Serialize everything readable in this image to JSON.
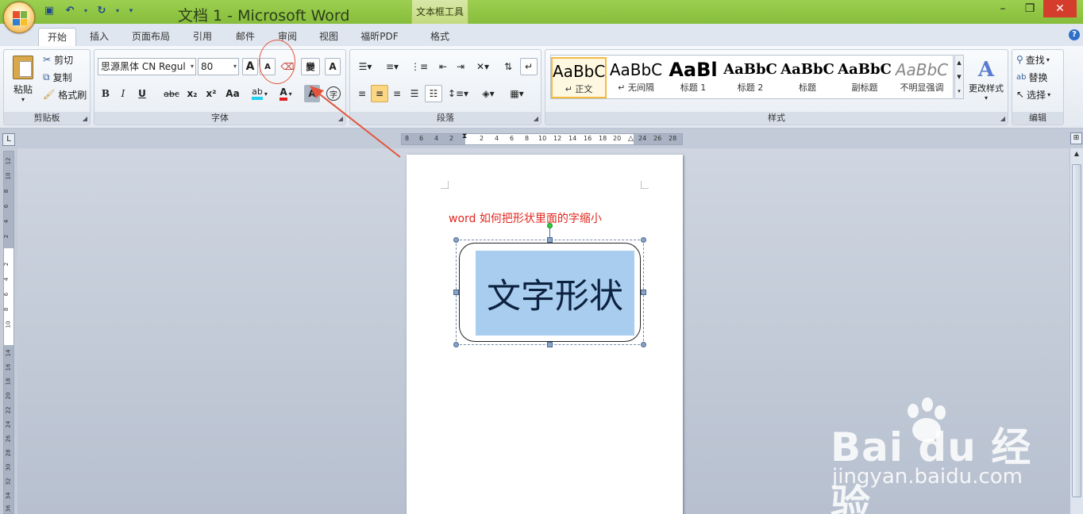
{
  "window": {
    "title": "文档 1 - Microsoft Word",
    "context_tool": "文本框工具",
    "controls": [
      "–",
      "❐",
      "✕"
    ]
  },
  "tabs": [
    {
      "label": "开始",
      "active": true
    },
    {
      "label": "插入"
    },
    {
      "label": "页面布局"
    },
    {
      "label": "引用"
    },
    {
      "label": "邮件"
    },
    {
      "label": "审阅"
    },
    {
      "label": "视图"
    },
    {
      "label": "福昕PDF"
    },
    {
      "label": "格式"
    }
  ],
  "clipboard": {
    "label": "剪贴板",
    "paste": "粘贴",
    "cut": "剪切",
    "copy": "复制",
    "format_painter": "格式刷"
  },
  "font": {
    "label": "字体",
    "font_name": "思源黑体 CN Regul",
    "font_size": "80",
    "grow": "A",
    "shrink": "A",
    "bold": "B",
    "italic": "I",
    "underline": "U",
    "strike": "abc",
    "subscript": "x₂",
    "superscript": "x²",
    "case": "Aa",
    "highlight": "ab",
    "font_color": "A",
    "char_shading": "A",
    "phonetic": "wén\n文",
    "border_char": "A",
    "enclose": "字"
  },
  "paragraph": {
    "label": "段落"
  },
  "styles": {
    "label": "样式",
    "items": [
      {
        "preview": "AaBbC",
        "name": "↵ 正文",
        "selected": true
      },
      {
        "preview": "AaBbC",
        "name": "↵ 无间隔"
      },
      {
        "preview": "AaBl",
        "name": "标题 1"
      },
      {
        "preview": "AaBbC",
        "name": "标题 2"
      },
      {
        "preview": "AaBbC",
        "name": "标题"
      },
      {
        "preview": "AaBbC",
        "name": "副标题"
      },
      {
        "preview": "AaBbC",
        "name": "不明显强调"
      }
    ],
    "change_styles": "更改样式"
  },
  "editing": {
    "label": "编辑",
    "find": "查找",
    "replace": "替换",
    "select": "选择"
  },
  "hruler_numbers": [
    "8",
    "6",
    "4",
    "2",
    "2",
    "4",
    "6",
    "8",
    "10",
    "12",
    "14",
    "16",
    "18",
    "20",
    "24",
    "26",
    "28"
  ],
  "vruler_numbers": [
    "12",
    "10",
    "8",
    "6",
    "4",
    "2",
    "2",
    "4",
    "6",
    "8",
    "10",
    "14",
    "16",
    "18",
    "20",
    "22",
    "24",
    "26",
    "28",
    "30",
    "32",
    "34",
    "36"
  ],
  "document": {
    "heading": "word 如何把形状里面的字缩小",
    "shape_text": "文字形状"
  },
  "watermark": {
    "brand": "Bai du 经验",
    "site": "jingyan.baidu.com"
  },
  "colors": {
    "title_bar": "#87bd3c",
    "selection": "#a9cdee",
    "annotation": "#e2261c"
  }
}
